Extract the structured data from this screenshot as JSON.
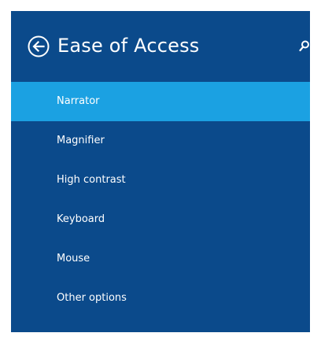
{
  "header": {
    "title": "Ease of Access",
    "back_icon": "back-arrow-circle-icon",
    "search_icon": "search-icon"
  },
  "colors": {
    "panel_background": "#0b4a8b",
    "selected_background": "#1ba1e2",
    "text": "#ffffff"
  },
  "menu": {
    "items": [
      {
        "label": "Narrator",
        "selected": true
      },
      {
        "label": "Magnifier",
        "selected": false
      },
      {
        "label": "High contrast",
        "selected": false
      },
      {
        "label": "Keyboard",
        "selected": false
      },
      {
        "label": "Mouse",
        "selected": false
      },
      {
        "label": "Other options",
        "selected": false
      }
    ]
  }
}
